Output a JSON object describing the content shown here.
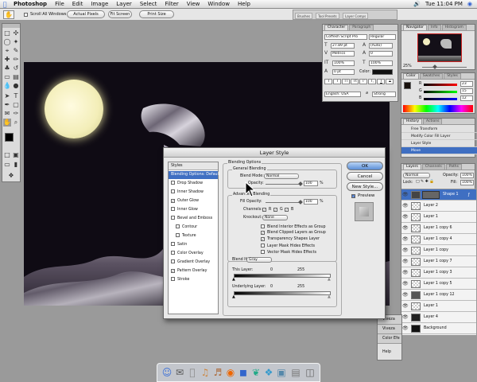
{
  "menubar": {
    "apple": "",
    "app": "Photoshop",
    "items": [
      "File",
      "Edit",
      "Image",
      "Layer",
      "Select",
      "Filter",
      "View",
      "Window",
      "Help"
    ],
    "clock": "Tue 11:04 PM"
  },
  "options_bar": {
    "scroll_all": "Scroll All Windows",
    "actual_pixels": "Actual Pixels",
    "fit_screen": "Fit Screen",
    "print_size": "Print Size",
    "well_tabs": [
      "Brushes",
      "Tool Presets",
      "Layer Comps"
    ]
  },
  "character_panel": {
    "tabs": [
      "Character",
      "Paragraph"
    ],
    "font": "Coffesh Script Pro",
    "style": "Regular",
    "size": "27.89 pt",
    "leading": "(Auto)",
    "kerning": "Metrics",
    "tracking": "0",
    "vscale": "100%",
    "hscale": "100%",
    "baseline": "0 pt",
    "color_label": "Color:",
    "language": "English: USA",
    "aa_label": "a",
    "aa": "Strong",
    "buttons": [
      "T",
      "T",
      "TT",
      "Tt",
      "T'",
      "T,",
      "T",
      "T"
    ]
  },
  "navigator_panel": {
    "tabs": [
      "Navigator",
      "Info",
      "Histogram"
    ],
    "zoom": "25%"
  },
  "color_panel": {
    "tabs": [
      "Color",
      "Swatches",
      "Styles"
    ],
    "rows": [
      {
        "label": "R",
        "value": "23"
      },
      {
        "label": "G",
        "value": "15"
      },
      {
        "label": "B",
        "value": "12"
      }
    ]
  },
  "history_panel": {
    "tabs": [
      "History",
      "Actions"
    ],
    "items": [
      "Free Transform",
      "Modify Color Fill Layer",
      "Layer Style",
      "Move"
    ]
  },
  "layers_panel": {
    "tabs": [
      "Layers",
      "Channels",
      "Paths"
    ],
    "mode": "Normal",
    "opacity_label": "Opacity:",
    "opacity": "100%",
    "lock_label": "Lock:",
    "fill_label": "Fill:",
    "fill": "100%",
    "layers": [
      "Shape 1",
      "Layer 2",
      "Layer 1",
      "Layer 1 copy 6",
      "Layer 1 copy 4",
      "Layer 1 copy",
      "Layer 1 copy 7",
      "Layer 1 copy 3",
      "Layer 1 copy 5",
      "Layer 1 copy 12",
      "Layer 1",
      "Layer 4",
      "Background"
    ]
  },
  "viveza": {
    "items": [
      "Viveza",
      "Viveza",
      "Color Efe"
    ],
    "help": "Help"
  },
  "dialog": {
    "title": "Layer Style",
    "styles_header": "Styles",
    "style_items": [
      {
        "label": "Blending Options: Default",
        "checked": null
      },
      {
        "label": "Drop Shadow",
        "checked": false
      },
      {
        "label": "Inner Shadow",
        "checked": false
      },
      {
        "label": "Outer Glow",
        "checked": true
      },
      {
        "label": "Inner Glow",
        "checked": false
      },
      {
        "label": "Bevel and Emboss",
        "checked": false
      },
      {
        "label": "Contour",
        "checked": false
      },
      {
        "label": "Texture",
        "checked": false
      },
      {
        "label": "Satin",
        "checked": false
      },
      {
        "label": "Color Overlay",
        "checked": false
      },
      {
        "label": "Gradient Overlay",
        "checked": false
      },
      {
        "label": "Pattern Overlay",
        "checked": true
      },
      {
        "label": "Stroke",
        "checked": false
      }
    ],
    "blending_options": "Blending Options",
    "general_blending": "General Blending",
    "blend_mode_label": "Blend Mode:",
    "blend_mode": "Normal",
    "opacity_label": "Opacity:",
    "opacity": "100",
    "opacity_fraction": 1.0,
    "percent": "%",
    "advanced_blending": "Advanced Blending",
    "fill_opacity_label": "Fill Opacity:",
    "fill_opacity": "100",
    "fill_opacity_fraction": 1.0,
    "channels_label": "Channels:",
    "channels": [
      "R",
      "G",
      "B"
    ],
    "knockout_label": "Knockout:",
    "knockout": "None",
    "options": [
      {
        "label": "Blend Interior Effects as Group",
        "checked": false
      },
      {
        "label": "Blend Clipped Layers as Group",
        "checked": true
      },
      {
        "label": "Transparency Shapes Layer",
        "checked": true
      },
      {
        "label": "Layer Mask Hides Effects",
        "checked": false
      },
      {
        "label": "Vector Mask Hides Effects",
        "checked": false
      }
    ],
    "blend_if_label": "Blend If:",
    "blend_if": "Gray",
    "this_layer_label": "This Layer:",
    "this_layer_min": "0",
    "this_layer_max": "255",
    "underlying_label": "Underlying Layer:",
    "underlying_min": "0",
    "underlying_max": "255",
    "ok": "OK",
    "cancel": "Cancel",
    "new_style": "New Style...",
    "preview": "Preview"
  }
}
